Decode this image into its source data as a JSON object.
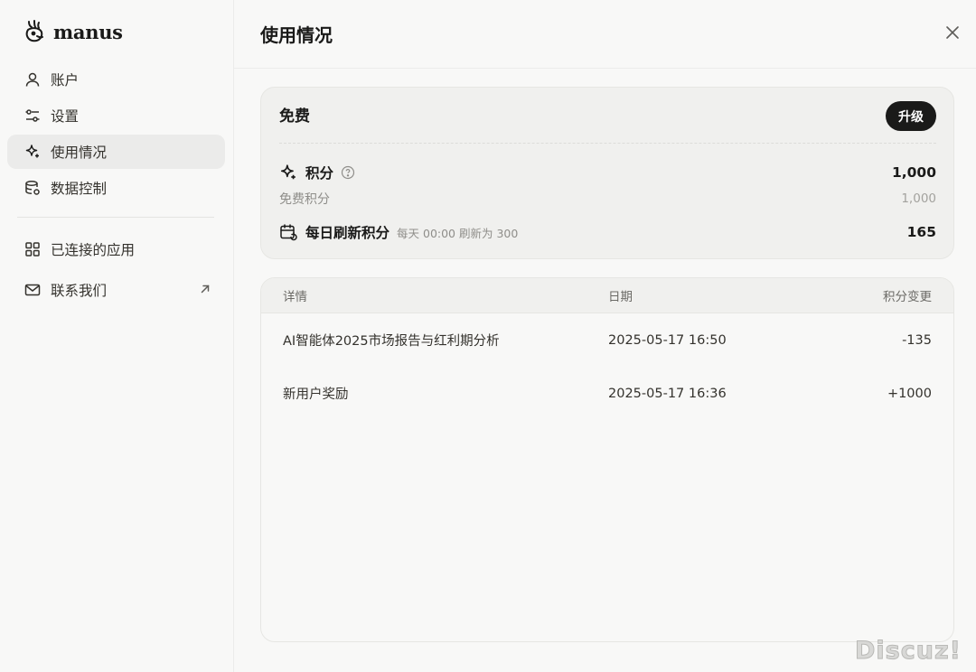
{
  "app": {
    "brand": "manus"
  },
  "sidebar": {
    "items": [
      {
        "label": "账户",
        "icon": "user-icon"
      },
      {
        "label": "设置",
        "icon": "sliders-icon"
      },
      {
        "label": "使用情况",
        "icon": "sparkle-icon",
        "active": true
      },
      {
        "label": "数据控制",
        "icon": "database-icon"
      }
    ],
    "secondary": [
      {
        "label": "已连接的应用",
        "icon": "grid-icon"
      },
      {
        "label": "联系我们",
        "icon": "mail-icon",
        "external": true
      }
    ]
  },
  "header": {
    "title": "使用情况"
  },
  "plan": {
    "name": "免费",
    "upgrade_label": "升级",
    "credits_label": "积分",
    "credits_value": "1,000",
    "free_credits_label": "免费积分",
    "free_credits_value": "1,000",
    "daily_label": "每日刷新积分",
    "daily_note": "每天 00:00 刷新为 300",
    "daily_value": "165"
  },
  "table": {
    "headers": [
      "详情",
      "日期",
      "积分变更"
    ],
    "rows": [
      {
        "detail": "AI智能体2025市场报告与红利期分析",
        "date": "2025-05-17 16:50",
        "change": "-135"
      },
      {
        "detail": "新用户奖励",
        "date": "2025-05-17 16:36",
        "change": "+1000"
      }
    ]
  },
  "watermark": "Discuz!",
  "colors": {
    "accent": "#1a1a19",
    "active_bg": "#ebebea",
    "card_bg": "#f0f0ee",
    "page_bg": "#f8f8f7"
  }
}
